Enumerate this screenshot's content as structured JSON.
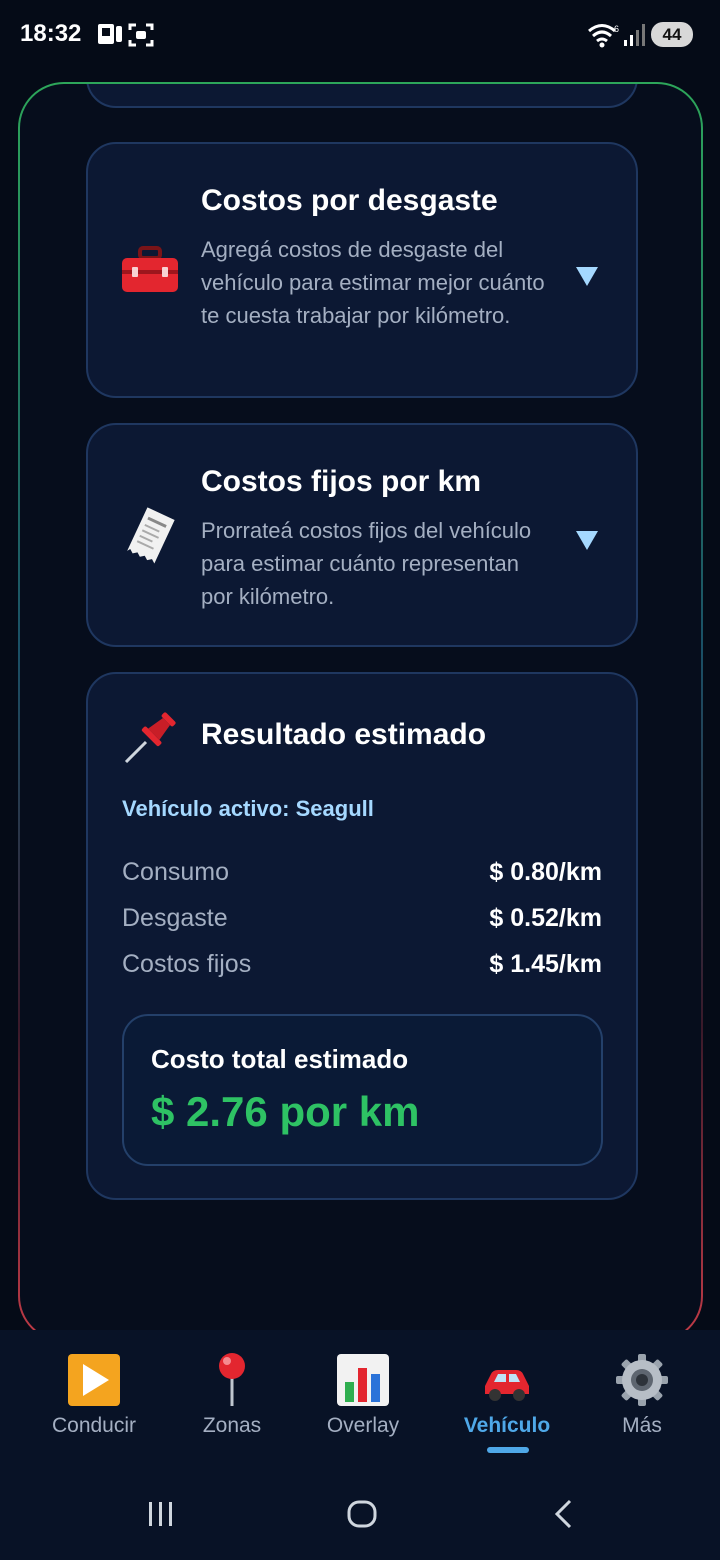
{
  "status_bar": {
    "time": "18:32",
    "battery": "44"
  },
  "cards": {
    "wear": {
      "icon": "toolbox-icon",
      "title": "Costos por desgaste",
      "description": "Agregá costos de desgaste del vehículo para estimar mejor cuánto te cuesta trabajar por kilómetro."
    },
    "fixed": {
      "icon": "receipt-icon",
      "title": "Costos fijos por km",
      "description": "Prorrateá costos fijos del vehículo para estimar cuánto representan por kilómetro."
    }
  },
  "result": {
    "icon": "pushpin-icon",
    "title": "Resultado estimado",
    "active_vehicle": "Vehículo activo: Seagull",
    "rows": [
      {
        "label": "Consumo",
        "value": "$ 0.80/km"
      },
      {
        "label": "Desgaste",
        "value": "$ 0.52/km"
      },
      {
        "label": "Costos fijos",
        "value": "$ 1.45/km"
      }
    ],
    "total_label": "Costo total estimado",
    "total_value": "$ 2.76 por km"
  },
  "bottom_nav": {
    "items": [
      {
        "label": "Conducir",
        "icon": "play-icon"
      },
      {
        "label": "Zonas",
        "icon": "map-pin-icon"
      },
      {
        "label": "Overlay",
        "icon": "bar-chart-icon"
      },
      {
        "label": "Vehículo",
        "icon": "car-icon",
        "active": true
      },
      {
        "label": "Más",
        "icon": "gear-icon"
      }
    ]
  },
  "colors": {
    "accent": "#4fa8e8",
    "total_green": "#2ec264",
    "card_bg": "#0c1833",
    "active_vehicle": "#a5d8ff"
  }
}
